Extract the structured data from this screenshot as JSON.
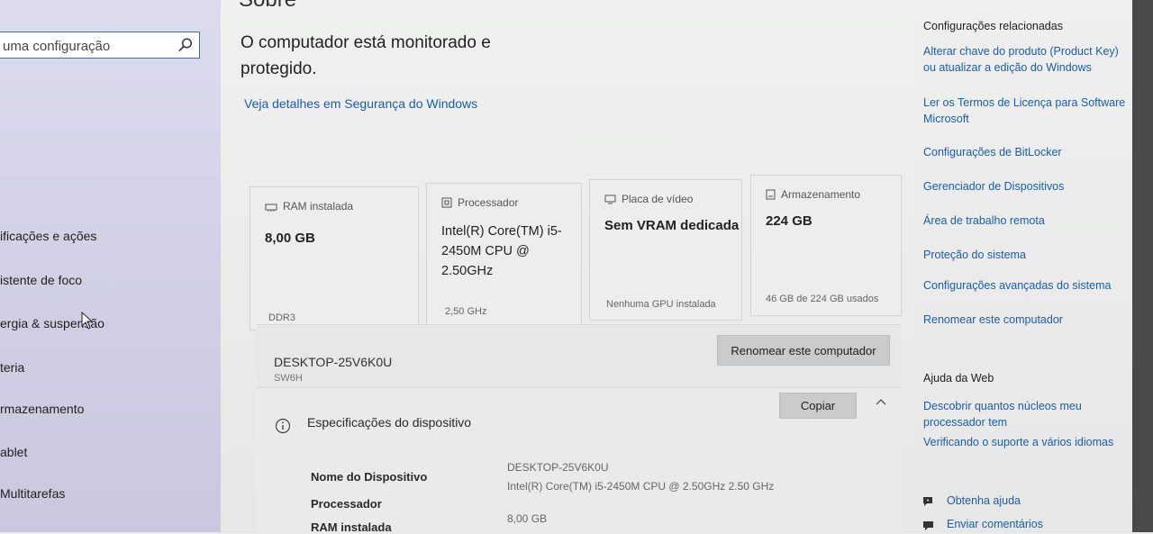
{
  "sidebar": {
    "search_placeholder": "uma configuração",
    "items": [
      "ificações e ações",
      "istente de foco",
      "ergia & suspensão",
      "teria",
      "rmazenamento",
      "ablet",
      "Multitarefas"
    ]
  },
  "main": {
    "title": "Sobre",
    "status": "O computador está monitorado e protegido.",
    "security_link": "Veja detalhes em Segurança do Windows",
    "cards": {
      "ram": {
        "label": "RAM instalada",
        "value": "8,00 GB",
        "sub": "DDR3"
      },
      "cpu": {
        "label": "Processador",
        "value": "Intel(R) Core(TM) i5-2450M CPU @ 2.50GHz",
        "sub": "2,50 GHz"
      },
      "gpu": {
        "label": "Placa de vídeo",
        "value": "Sem VRAM dedicada",
        "sub": "Nenhuma GPU instalada"
      },
      "storage": {
        "label": "Armazenamento",
        "value": "224 GB",
        "sub": "46 GB de 224 GB usados"
      }
    },
    "device": {
      "name": "DESKTOP-25V6K0U",
      "model": "SW6H",
      "rename_button": "Renomear este computador"
    },
    "specs": {
      "title": "Especificações do dispositivo",
      "copy_button": "Copiar",
      "rows": [
        {
          "label": "Nome do Dispositivo",
          "value": "DESKTOP-25V6K0U"
        },
        {
          "label": "Processador",
          "value": "Intel(R) Core(TM) i5-2450M CPU @ 2.50GHz   2.50 GHz"
        },
        {
          "label": "RAM instalada",
          "value": "8,00 GB"
        }
      ]
    }
  },
  "right": {
    "related_title": "Configurações relacionadas",
    "related_links": [
      "Alterar chave do produto (Product Key) ou atualizar a edição do Windows",
      "Ler os Termos de Licença para Software Microsoft",
      "Configurações de BitLocker",
      "Gerenciador de Dispositivos",
      "Área de trabalho remota",
      "Proteção do sistema",
      "Configurações avançadas do sistema",
      "Renomear este computador"
    ],
    "help_title": "Ajuda da Web",
    "help_links": [
      "Descobrir quantos núcleos meu processador tem",
      "Verificando o suporte a vários idiomas"
    ],
    "get_help": "Obtenha ajuda",
    "feedback": "Enviar comentários"
  },
  "colors": {
    "accent_link": "#1a5ea8",
    "sidebar_bg": "#d2d1e6",
    "button_bg": "#c9cbcd"
  }
}
